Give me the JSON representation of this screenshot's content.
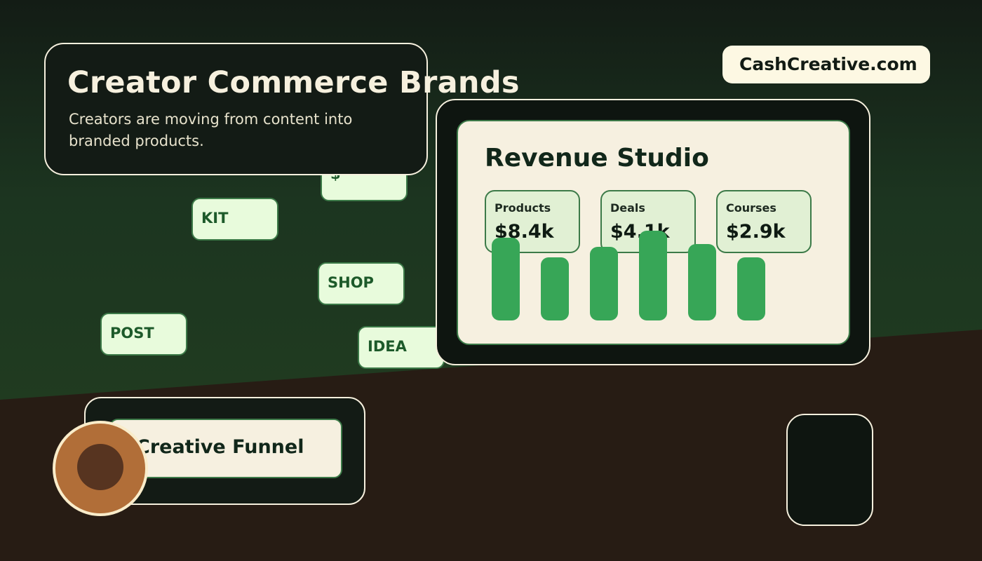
{
  "header": {
    "title": "Creator Commerce Brands",
    "subtitle": "Creators are moving from content into branded products."
  },
  "brand": {
    "label": "CashCreative.com"
  },
  "chips": {
    "dollar": "$",
    "kit": "KIT",
    "shop": "SHOP",
    "post": "POST",
    "idea": "IDEA"
  },
  "revenue_studio": {
    "title": "Revenue Studio",
    "stats": [
      {
        "label": "Products",
        "value": "$8.4k"
      },
      {
        "label": "Deals",
        "value": "$4.1k"
      },
      {
        "label": "Courses",
        "value": "$2.9k"
      }
    ]
  },
  "chart_data": {
    "type": "bar",
    "title": "",
    "categories": [
      "",
      "",
      "",
      "",
      "",
      ""
    ],
    "values": [
      118,
      90,
      105,
      128,
      109,
      90
    ],
    "ylim": [
      0,
      128
    ]
  },
  "funnel": {
    "label": "Creative Funnel"
  },
  "colors": {
    "green_dark": "#1f3a21",
    "green_bar": "#37a657",
    "cream": "#f6f0de",
    "brown": "#271c14",
    "coin": "#b16e38"
  }
}
